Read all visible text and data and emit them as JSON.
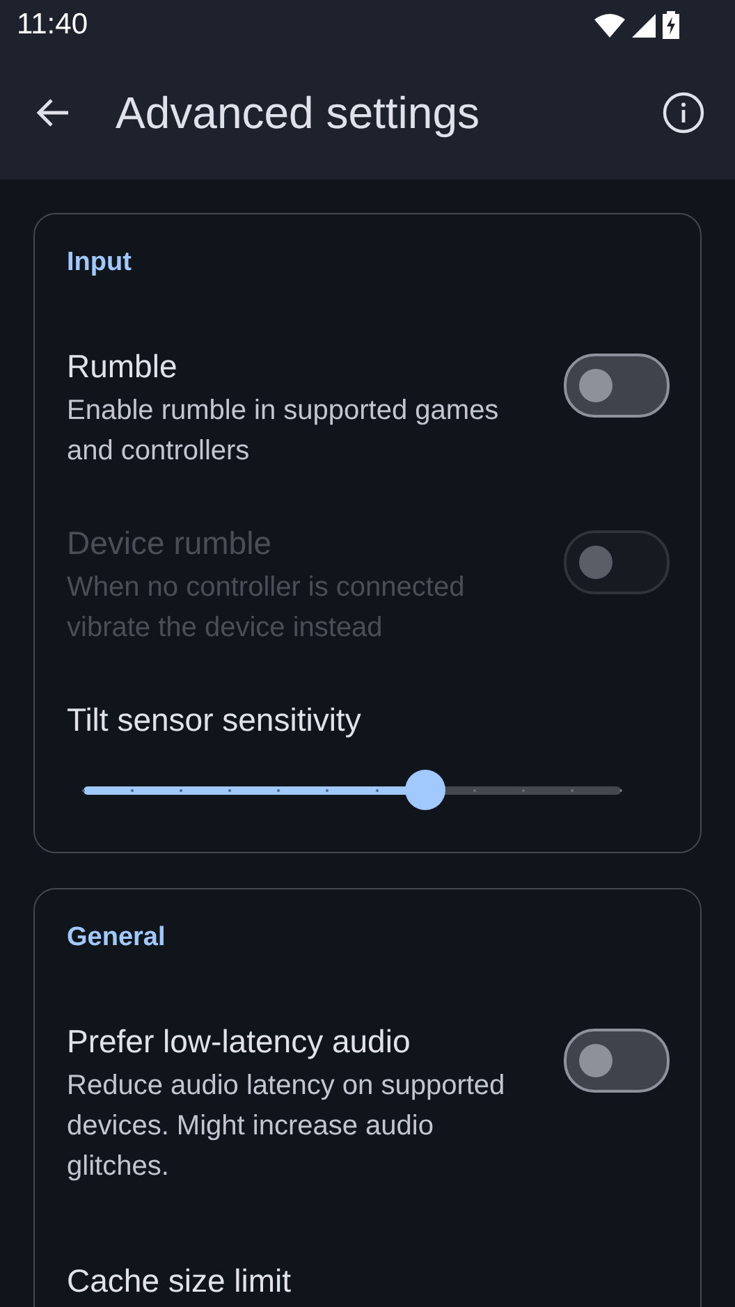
{
  "status_bar": {
    "time": "11:40"
  },
  "app_bar": {
    "title": "Advanced settings"
  },
  "sections": [
    {
      "title": "Input",
      "items": [
        {
          "kind": "switch",
          "title": "Rumble",
          "subtitle": "Enable rumble in supported games and controllers",
          "on": false,
          "disabled": false
        },
        {
          "kind": "switch",
          "title": "Device rumble",
          "subtitle": "When no controller is connected vibrate the device instead",
          "on": false,
          "disabled": true
        },
        {
          "kind": "slider",
          "title": "Tilt sensor sensitivity",
          "level": 0.636
        }
      ]
    },
    {
      "title": "General",
      "items": [
        {
          "kind": "switch",
          "title": "Prefer low-latency audio",
          "subtitle": "Reduce audio latency on supported devices. Might increase audio glitches.",
          "on": false,
          "disabled": false
        },
        {
          "kind": "label",
          "title": "Cache size limit"
        }
      ]
    }
  ]
}
